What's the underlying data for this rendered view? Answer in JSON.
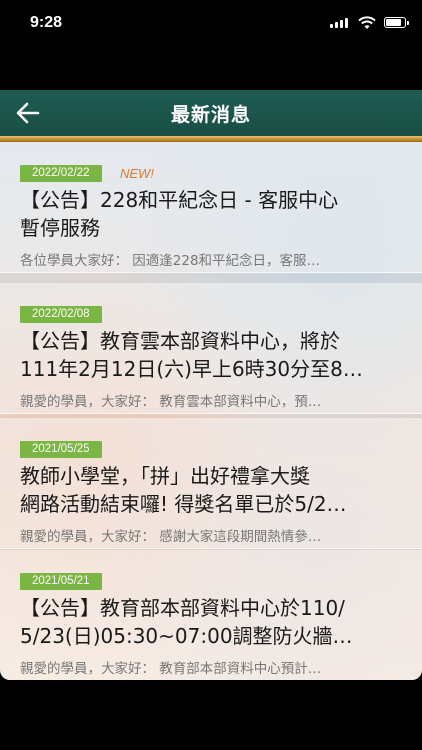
{
  "status_bar": {
    "time": "9:28"
  },
  "header": {
    "title": "最新消息"
  },
  "news": [
    {
      "date": "2022/02/22",
      "badge": "NEW!",
      "title_line1": "【公告】228和平紀念日 - 客服中心",
      "title_line2": "暫停服務",
      "excerpt": "各位學員大家好： 因適逢228和平紀念日，客服…"
    },
    {
      "date": "2022/02/08",
      "title_line1": "【公告】教育雲本部資料中心，將於",
      "title_line2": "111年2月12日(六)早上6時30分至8…",
      "excerpt": "親愛的學員，大家好： 教育雲本部資料中心，預…"
    },
    {
      "date": "2021/05/25",
      "title_line1": "教師小學堂，「拼」出好禮拿大獎",
      "title_line2": "網路活動結束囉! 得獎名單已於5/2…",
      "excerpt": "親愛的學員，大家好： 感謝大家這段期間熱情參…"
    },
    {
      "date": "2021/05/21",
      "title_line1": "【公告】教育部本部資料中心於110/",
      "title_line2": "5/23(日)05:30~07:00調整防火牆…",
      "excerpt": "親愛的學員，大家好： 教育部本部資料中心預計…"
    }
  ]
}
